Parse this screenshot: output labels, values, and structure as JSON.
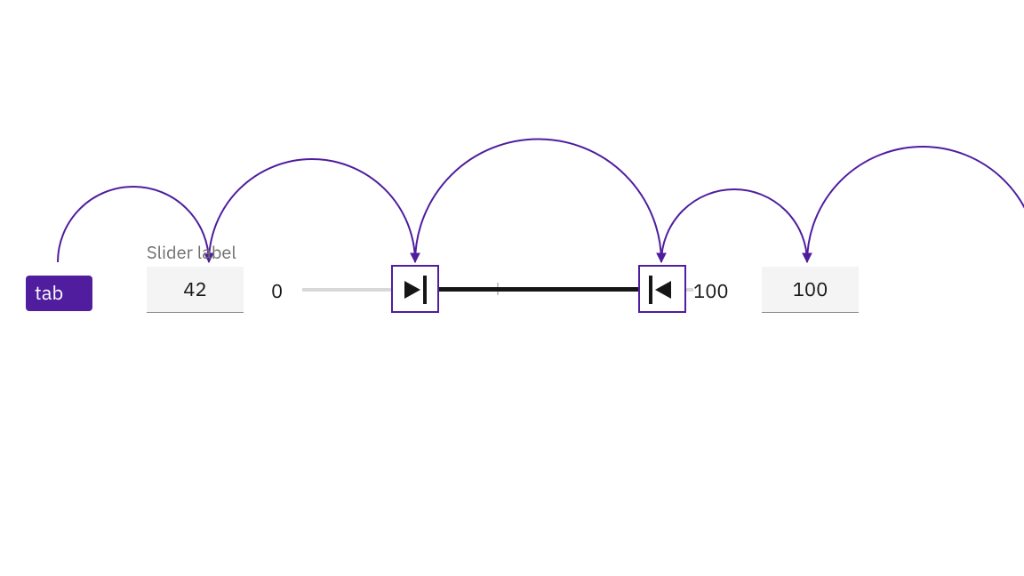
{
  "colors": {
    "accent": "#4f1d9e",
    "text": "#161616",
    "muted": "#6f6f6f",
    "input_bg": "#f4f4f4"
  },
  "tab": {
    "label": "tab"
  },
  "slider": {
    "label": "Slider label",
    "value_left_input": "42",
    "min": "0",
    "max": "100",
    "value_right_input": "100"
  }
}
